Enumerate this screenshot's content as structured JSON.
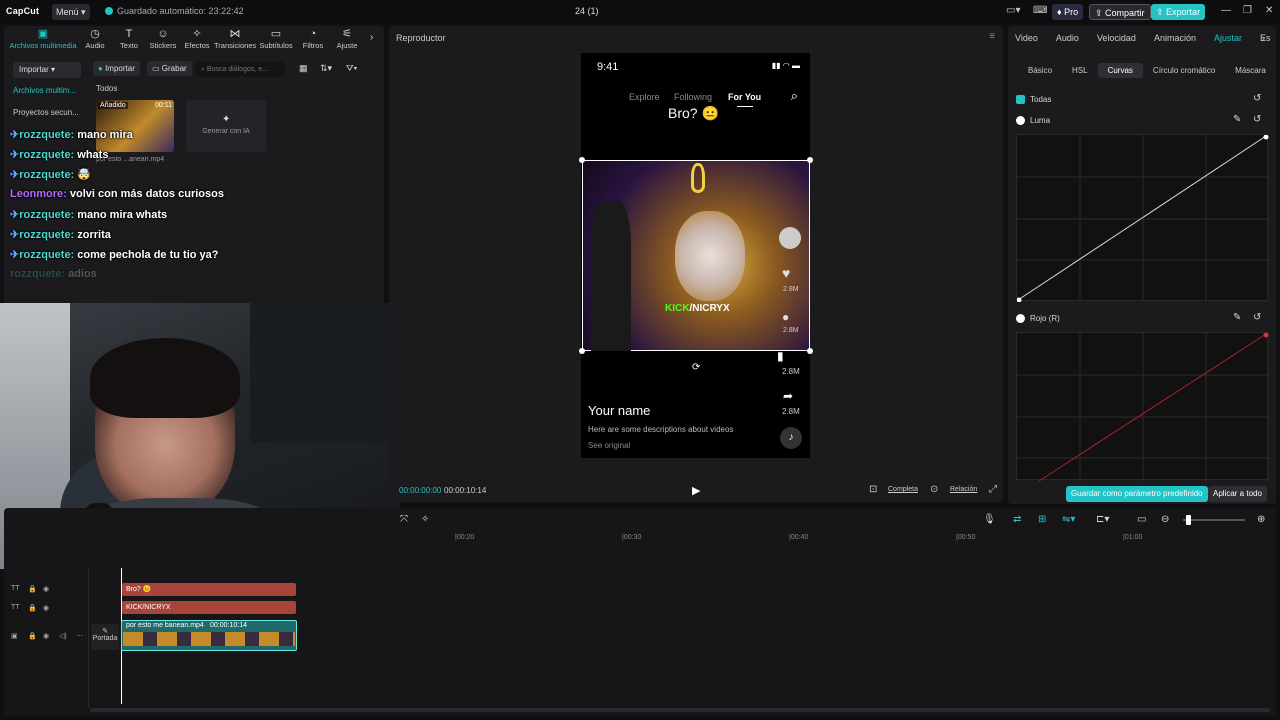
{
  "titlebar": {
    "logo": "CapCut",
    "menu_label": "Menú",
    "autosave": "Guardado automático: 23:22:42",
    "project_title": "24 (1)",
    "pro_label": "Pro",
    "share_label": "Compartir",
    "export_label": "Exportar"
  },
  "toolbar": {
    "items": [
      "Archivos multimedia",
      "Audio",
      "Texto",
      "Stickers",
      "Efectos",
      "Transiciones",
      "Subtítulos",
      "Filtros",
      "Ajuste"
    ]
  },
  "media": {
    "import_dropdown": "Importar",
    "import_button": "Importar",
    "record_button": "Grabar",
    "search_placeholder": "Busca diálogos, e...",
    "sidebar": [
      "Archivos multim...",
      "Proyectos secun..."
    ],
    "filter_all": "Todos",
    "thumb_badge": "Añadido",
    "thumb_duration": "00:11",
    "thumb_name": "por esto ...anean.mp4",
    "generate_ai": "Generar con IA"
  },
  "chat": [
    {
      "user": "rozzquete:",
      "msg": "mano mira"
    },
    {
      "user": "rozzquete:",
      "msg": "whats"
    },
    {
      "user": "rozzquete:",
      "msg": "🤯"
    },
    {
      "user": "Leonmore:",
      "msg": "volvi con más datos curiosos"
    },
    {
      "user": "rozzquete:",
      "msg": "mano mira whats"
    },
    {
      "user": "rozzquete:",
      "msg": "zorrita"
    },
    {
      "user": "rozzquete:",
      "msg": "come pechola de tu tio ya?"
    },
    {
      "user": "rozzquete:",
      "msg": "adios"
    }
  ],
  "player": {
    "title": "Reproductor",
    "phone_time": "9:41",
    "nav": [
      "Explore",
      "Following",
      "For You"
    ],
    "caption": "Bro? 😐",
    "video_text": "KICK/NICRYX",
    "counts": [
      "2.8M",
      "2.8M",
      "2.8M",
      "2.8M"
    ],
    "username": "Your name",
    "description": "Here are some descriptions about videos",
    "see_original": "See original",
    "time_current": "00:00:00:00",
    "time_total": "00:00:10:14",
    "full_label": "Completa",
    "ratio_label": "Relación"
  },
  "right": {
    "tabs": [
      "Video",
      "Audio",
      "Velocidad",
      "Animación",
      "Ajustar",
      "Es"
    ],
    "subtabs": [
      "Básico",
      "HSL",
      "Curvas",
      "Círculo cromático",
      "Máscara"
    ],
    "all_label": "Todas",
    "luma_label": "Luma",
    "red_label": "Rojo (R)",
    "save_preset": "Guardar como parámetro predefinido",
    "apply_all": "Aplicar a todo"
  },
  "timeline": {
    "ruler": [
      "|00:20",
      "|00:30",
      "|00:40",
      "|00:50",
      "|01:00"
    ],
    "clip_text1": "Bro? 😐",
    "clip_text2": "KICK/NICRYX",
    "clip_video": "por esto me banean.mp4",
    "clip_video_duration": "00:00:10:14",
    "cover_label": "Portada"
  },
  "colors": {
    "accent": "#23c3c6",
    "text_clip": "#a8443a",
    "video_clip": "#1f6b6b"
  }
}
